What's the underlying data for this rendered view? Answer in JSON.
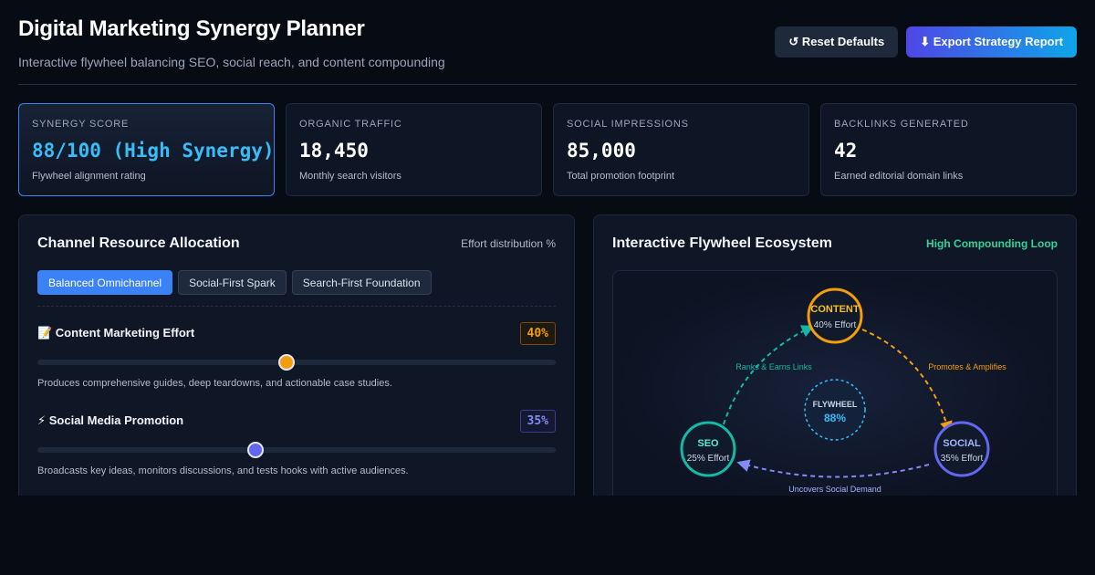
{
  "header": {
    "title": "Digital Marketing Synergy Planner",
    "subtitle": "Interactive flywheel balancing SEO, social reach, and content compounding",
    "reset_label": "↺ Reset Defaults",
    "export_label": "⬇ Export Strategy Report"
  },
  "stats": [
    {
      "label": "SYNERGY SCORE",
      "value": "88/100 (High Synergy)",
      "desc": "Flywheel alignment rating"
    },
    {
      "label": "ORGANIC TRAFFIC",
      "value": "18,450",
      "desc": "Monthly search visitors"
    },
    {
      "label": "SOCIAL IMPRESSIONS",
      "value": "85,000",
      "desc": "Total promotion footprint"
    },
    {
      "label": "BACKLINKS GENERATED",
      "value": "42",
      "desc": "Earned editorial domain links"
    }
  ],
  "allocation": {
    "title": "Channel Resource Allocation",
    "tag": "Effort distribution %",
    "presets": [
      {
        "label": "Balanced Omnichannel",
        "active": true
      },
      {
        "label": "Social-First Spark",
        "active": false
      },
      {
        "label": "Search-First Foundation",
        "active": false
      }
    ],
    "channels": [
      {
        "name": "📝 Content Marketing Effort",
        "pct_label": "40%",
        "value": 0.4,
        "desc": "Produces comprehensive guides, deep teardowns, and actionable case studies."
      },
      {
        "name": "⚡ Social Media Promotion",
        "pct_label": "35%",
        "value": 0.35,
        "desc": "Broadcasts key ideas, monitors discussions, and tests hooks with active audiences."
      }
    ]
  },
  "flywheel": {
    "title": "Interactive Flywheel Ecosystem",
    "tag": "High Compounding Loop",
    "center_label": "FLYWHEEL",
    "center_value": "88%",
    "nodes": {
      "content": {
        "name": "CONTENT",
        "effort": "40% Effort"
      },
      "seo": {
        "name": "SEO",
        "effort": "25% Effort"
      },
      "social": {
        "name": "SOCIAL",
        "effort": "35% Effort"
      }
    },
    "links": {
      "seo_to_content": "Ranks & Earns Links",
      "content_to_social": "Promotes & Amplifies",
      "social_to_seo": "Uncovers Social Demand"
    }
  },
  "colors": {
    "content": "#f59e0b",
    "seo": "#14b8a6",
    "social": "#6366f1",
    "center": "#38bdf8",
    "accent": "#3b82f6"
  }
}
